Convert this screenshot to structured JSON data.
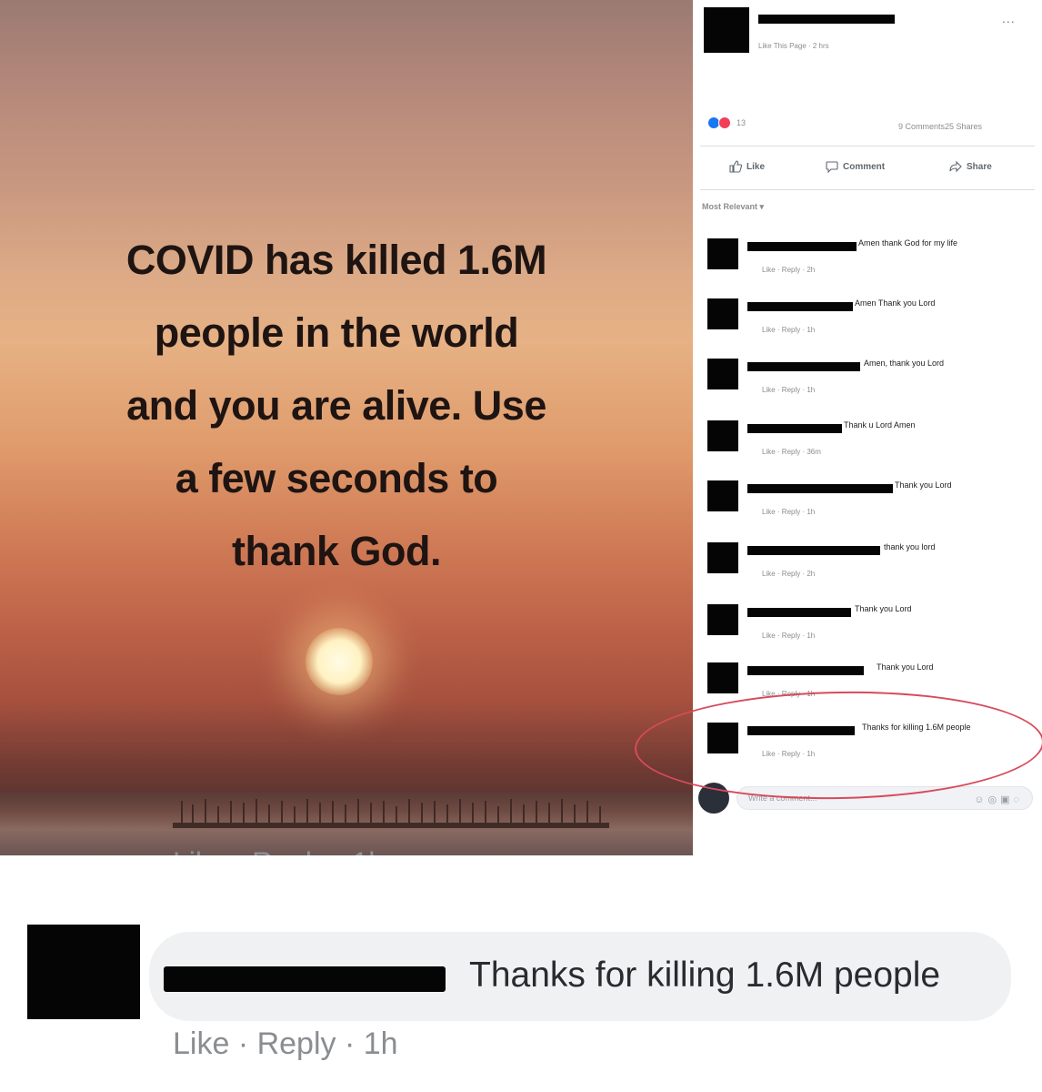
{
  "image": {
    "headline_lines": [
      "COVID has killed 1.6M",
      "people in the world",
      "and you are alive. Use",
      "a few seconds to",
      "thank God."
    ],
    "bottom_action": "Like · Reply · 1h"
  },
  "post": {
    "subline": "Like This Page · 2 hrs",
    "more": "...",
    "reactions_count": "13",
    "counts": "9 Comments25 Shares",
    "actions": {
      "like": "Like",
      "comment": "Comment",
      "share": "Share"
    },
    "sort": "Most Relevant ▾",
    "comments": [
      {
        "text": "Amen thank God for my life",
        "meta": "Like · Reply · 2h"
      },
      {
        "text": "Amen  Thank you Lord",
        "meta": "Like · Reply · 1h"
      },
      {
        "text": "Amen, thank you Lord",
        "meta": "Like · Reply · 1h"
      },
      {
        "text": "Thank u Lord  Amen",
        "meta": "Like · Reply · 36m"
      },
      {
        "text": "Thank you Lord",
        "meta": "Like · Reply · 1h"
      },
      {
        "text": "thank you lord",
        "meta": "Like · Reply · 2h"
      },
      {
        "text": "Thank you Lord",
        "meta": "Like · Reply · 1h"
      },
      {
        "text": "Thank you Lord",
        "meta": "Like · Reply · 1h"
      },
      {
        "text": "Thanks for killing 1.6M people",
        "meta": "Like · Reply · 1h"
      }
    ],
    "write_placeholder": "Write a comment...",
    "colors": {
      "reaction_blue": "#1877f2",
      "reaction_red": "#f33e58",
      "highlight_circle": "#d84a5a"
    }
  },
  "zoomed_comment": {
    "text": "Thanks for killing 1.6M people",
    "meta": "Like · Reply · 1h"
  }
}
